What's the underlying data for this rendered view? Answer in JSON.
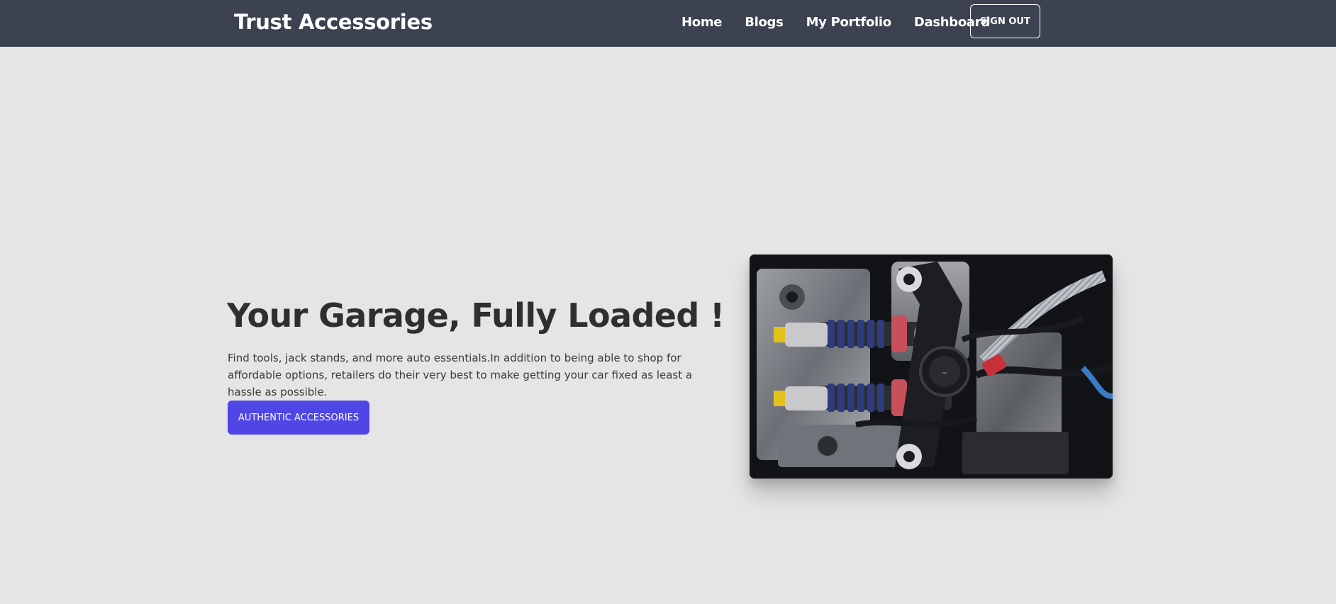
{
  "nav": {
    "brand": "Trust Accessories",
    "links": [
      {
        "label": "Home"
      },
      {
        "label": "Blogs"
      },
      {
        "label": "My Portfolio"
      },
      {
        "label": "Dashboard"
      }
    ],
    "signout_label": "SIGN OUT"
  },
  "hero": {
    "title": "Your Garage, Fully Loaded !",
    "description": "Find tools, jack stands, and more auto essentials.In addition to being able to shop for affordable options, retailers do their very best to make getting your car fixed as least a hassle as possible.",
    "cta_label": "AUTHENTIC ACCESSORIES",
    "image_subject": "engine-bay-with-suspension-coilovers"
  },
  "colors": {
    "navbar_bg": "#3c4250",
    "page_bg": "#e5e5e5",
    "cta_bg": "#4f46e5",
    "title_text": "#2f2f2f"
  }
}
